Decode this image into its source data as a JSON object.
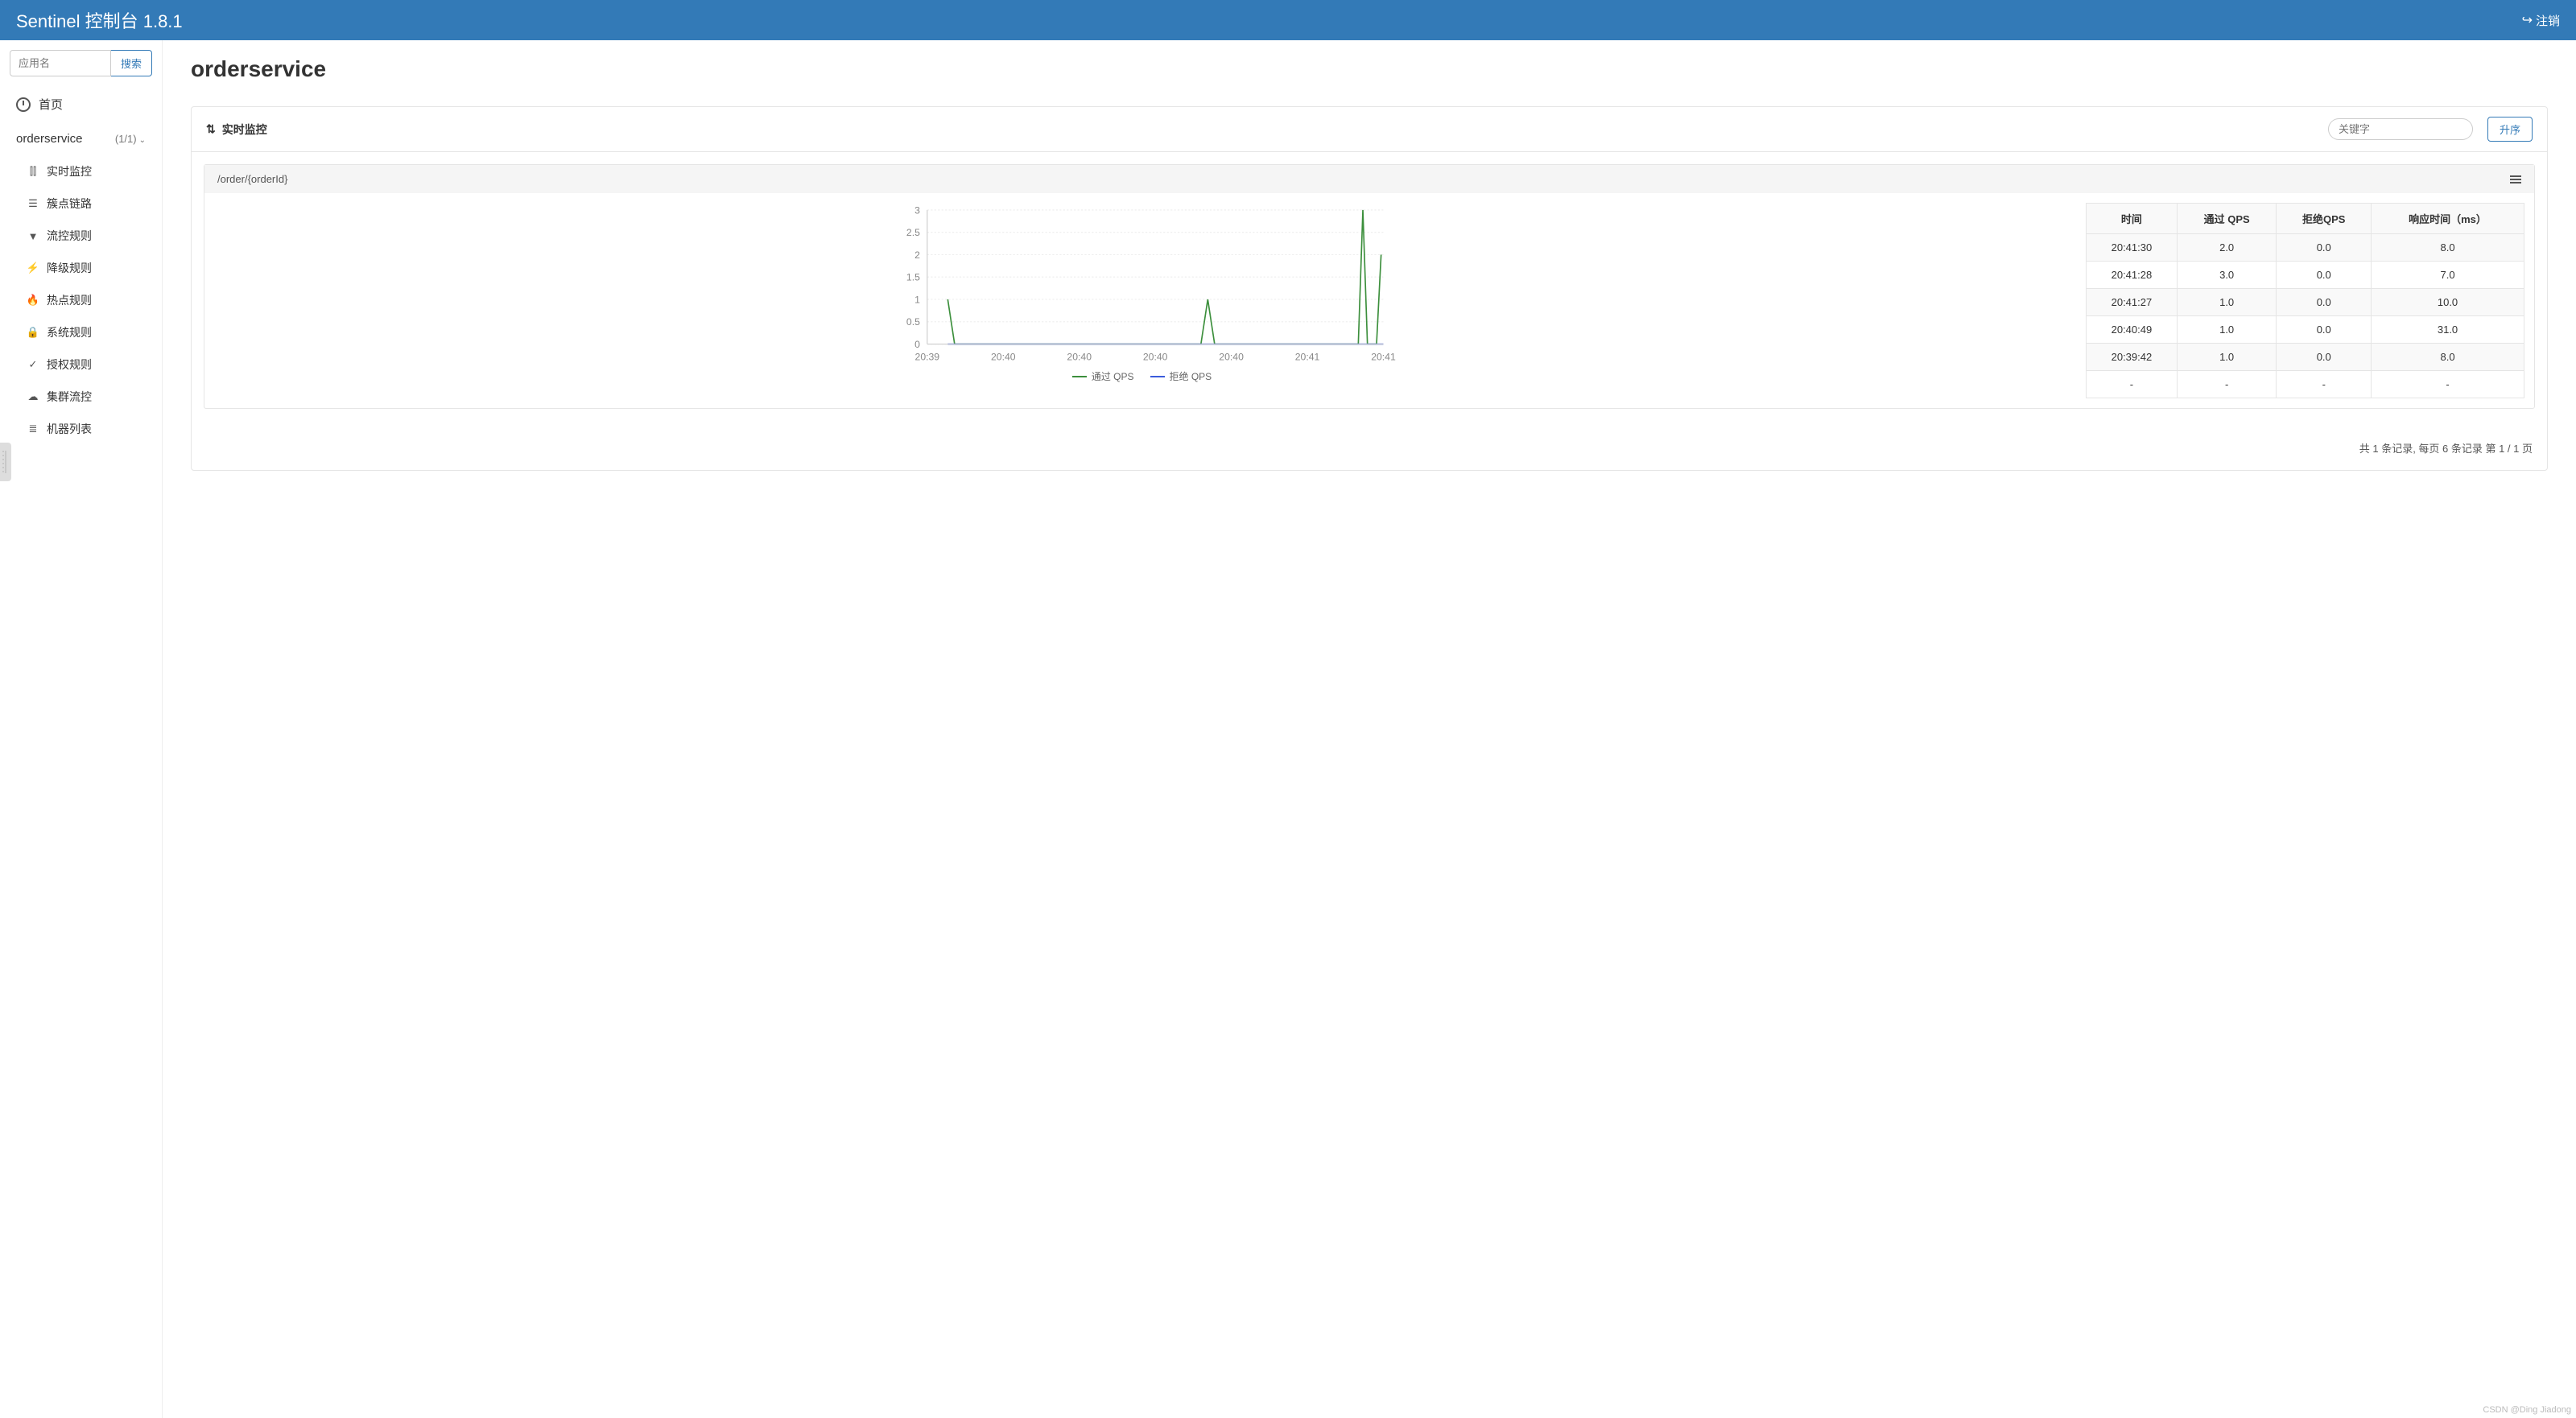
{
  "header": {
    "title": "Sentinel 控制台 1.8.1",
    "logout": "注销"
  },
  "sidebar": {
    "search_placeholder": "应用名",
    "search_btn": "搜索",
    "home": "首页",
    "app_name": "orderservice",
    "app_count": "(1/1)",
    "items": [
      {
        "icon": "bars",
        "label": "实时监控"
      },
      {
        "icon": "list",
        "label": "簇点链路"
      },
      {
        "icon": "filter",
        "label": "流控规则"
      },
      {
        "icon": "bolt",
        "label": "降级规则"
      },
      {
        "icon": "fire",
        "label": "热点规则"
      },
      {
        "icon": "lock",
        "label": "系统规则"
      },
      {
        "icon": "check",
        "label": "授权规则"
      },
      {
        "icon": "cloud",
        "label": "集群流控"
      },
      {
        "icon": "server",
        "label": "机器列表"
      }
    ]
  },
  "main": {
    "title": "orderservice",
    "panel_title": "实时监控",
    "kw_placeholder": "关键字",
    "sort_btn": "升序",
    "resource": "/order/{orderId}",
    "legend_pass": "通过 QPS",
    "legend_block": "拒绝 QPS",
    "table_headers": [
      "时间",
      "通过 QPS",
      "拒绝QPS",
      "响应时间（ms）"
    ],
    "table_rows": [
      [
        "20:41:30",
        "2.0",
        "0.0",
        "8.0"
      ],
      [
        "20:41:28",
        "3.0",
        "0.0",
        "7.0"
      ],
      [
        "20:41:27",
        "1.0",
        "0.0",
        "10.0"
      ],
      [
        "20:40:49",
        "1.0",
        "0.0",
        "31.0"
      ],
      [
        "20:39:42",
        "1.0",
        "0.0",
        "8.0"
      ],
      [
        "-",
        "-",
        "-",
        "-"
      ]
    ],
    "footer": "共 1 条记录, 每页 6 条记录 第 1 / 1 页"
  },
  "chart_data": {
    "type": "line",
    "x_ticks": [
      "20:39",
      "20:40",
      "20:40",
      "20:40",
      "20:40",
      "20:41",
      "20:41"
    ],
    "y_ticks": [
      0,
      0.5,
      1,
      1.5,
      2,
      2.5,
      3
    ],
    "ylim": [
      0,
      3
    ],
    "series": [
      {
        "name": "通过 QPS",
        "color": "#3c8f3c",
        "points": [
          {
            "x": 0.045,
            "y": 1
          },
          {
            "x": 0.06,
            "y": 0
          },
          {
            "x": 0.6,
            "y": 0
          },
          {
            "x": 0.615,
            "y": 1
          },
          {
            "x": 0.63,
            "y": 0
          },
          {
            "x": 0.945,
            "y": 0
          },
          {
            "x": 0.955,
            "y": 3
          },
          {
            "x": 0.965,
            "y": 0
          },
          {
            "x": 0.985,
            "y": 0
          },
          {
            "x": 0.995,
            "y": 2
          }
        ]
      },
      {
        "name": "拒绝 QPS",
        "color": "#3b5bdb",
        "points": [
          {
            "x": 0.045,
            "y": 0
          },
          {
            "x": 1.0,
            "y": 0
          }
        ]
      }
    ]
  },
  "watermark": "CSDN @Ding Jiadong"
}
